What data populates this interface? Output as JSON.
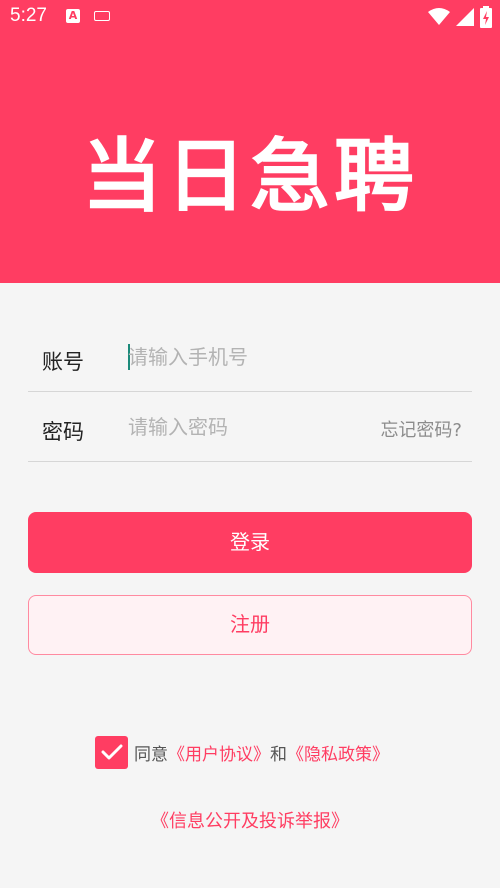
{
  "status_bar": {
    "time": "5:27",
    "notification_letter": "A"
  },
  "header": {
    "app_title": "当日急聘",
    "background_color": "#ff3d62"
  },
  "login_form": {
    "account": {
      "label": "账号",
      "placeholder": "请输入手机号",
      "value": ""
    },
    "password": {
      "label": "密码",
      "placeholder": "请输入密码",
      "value": "",
      "forgot_label": "忘记密码?"
    },
    "login_label": "登录",
    "register_label": "注册"
  },
  "agreement": {
    "checked": true,
    "prefix": "同意",
    "user_agreement": "《用户协议》",
    "conjunction": "和",
    "privacy_policy": "《隐私政策》"
  },
  "info_disclosure_link": "《信息公开及投诉举报》",
  "colors": {
    "accent": "#ff3d62",
    "register_bg": "#fff2f4",
    "placeholder": "#b3b3b3"
  }
}
